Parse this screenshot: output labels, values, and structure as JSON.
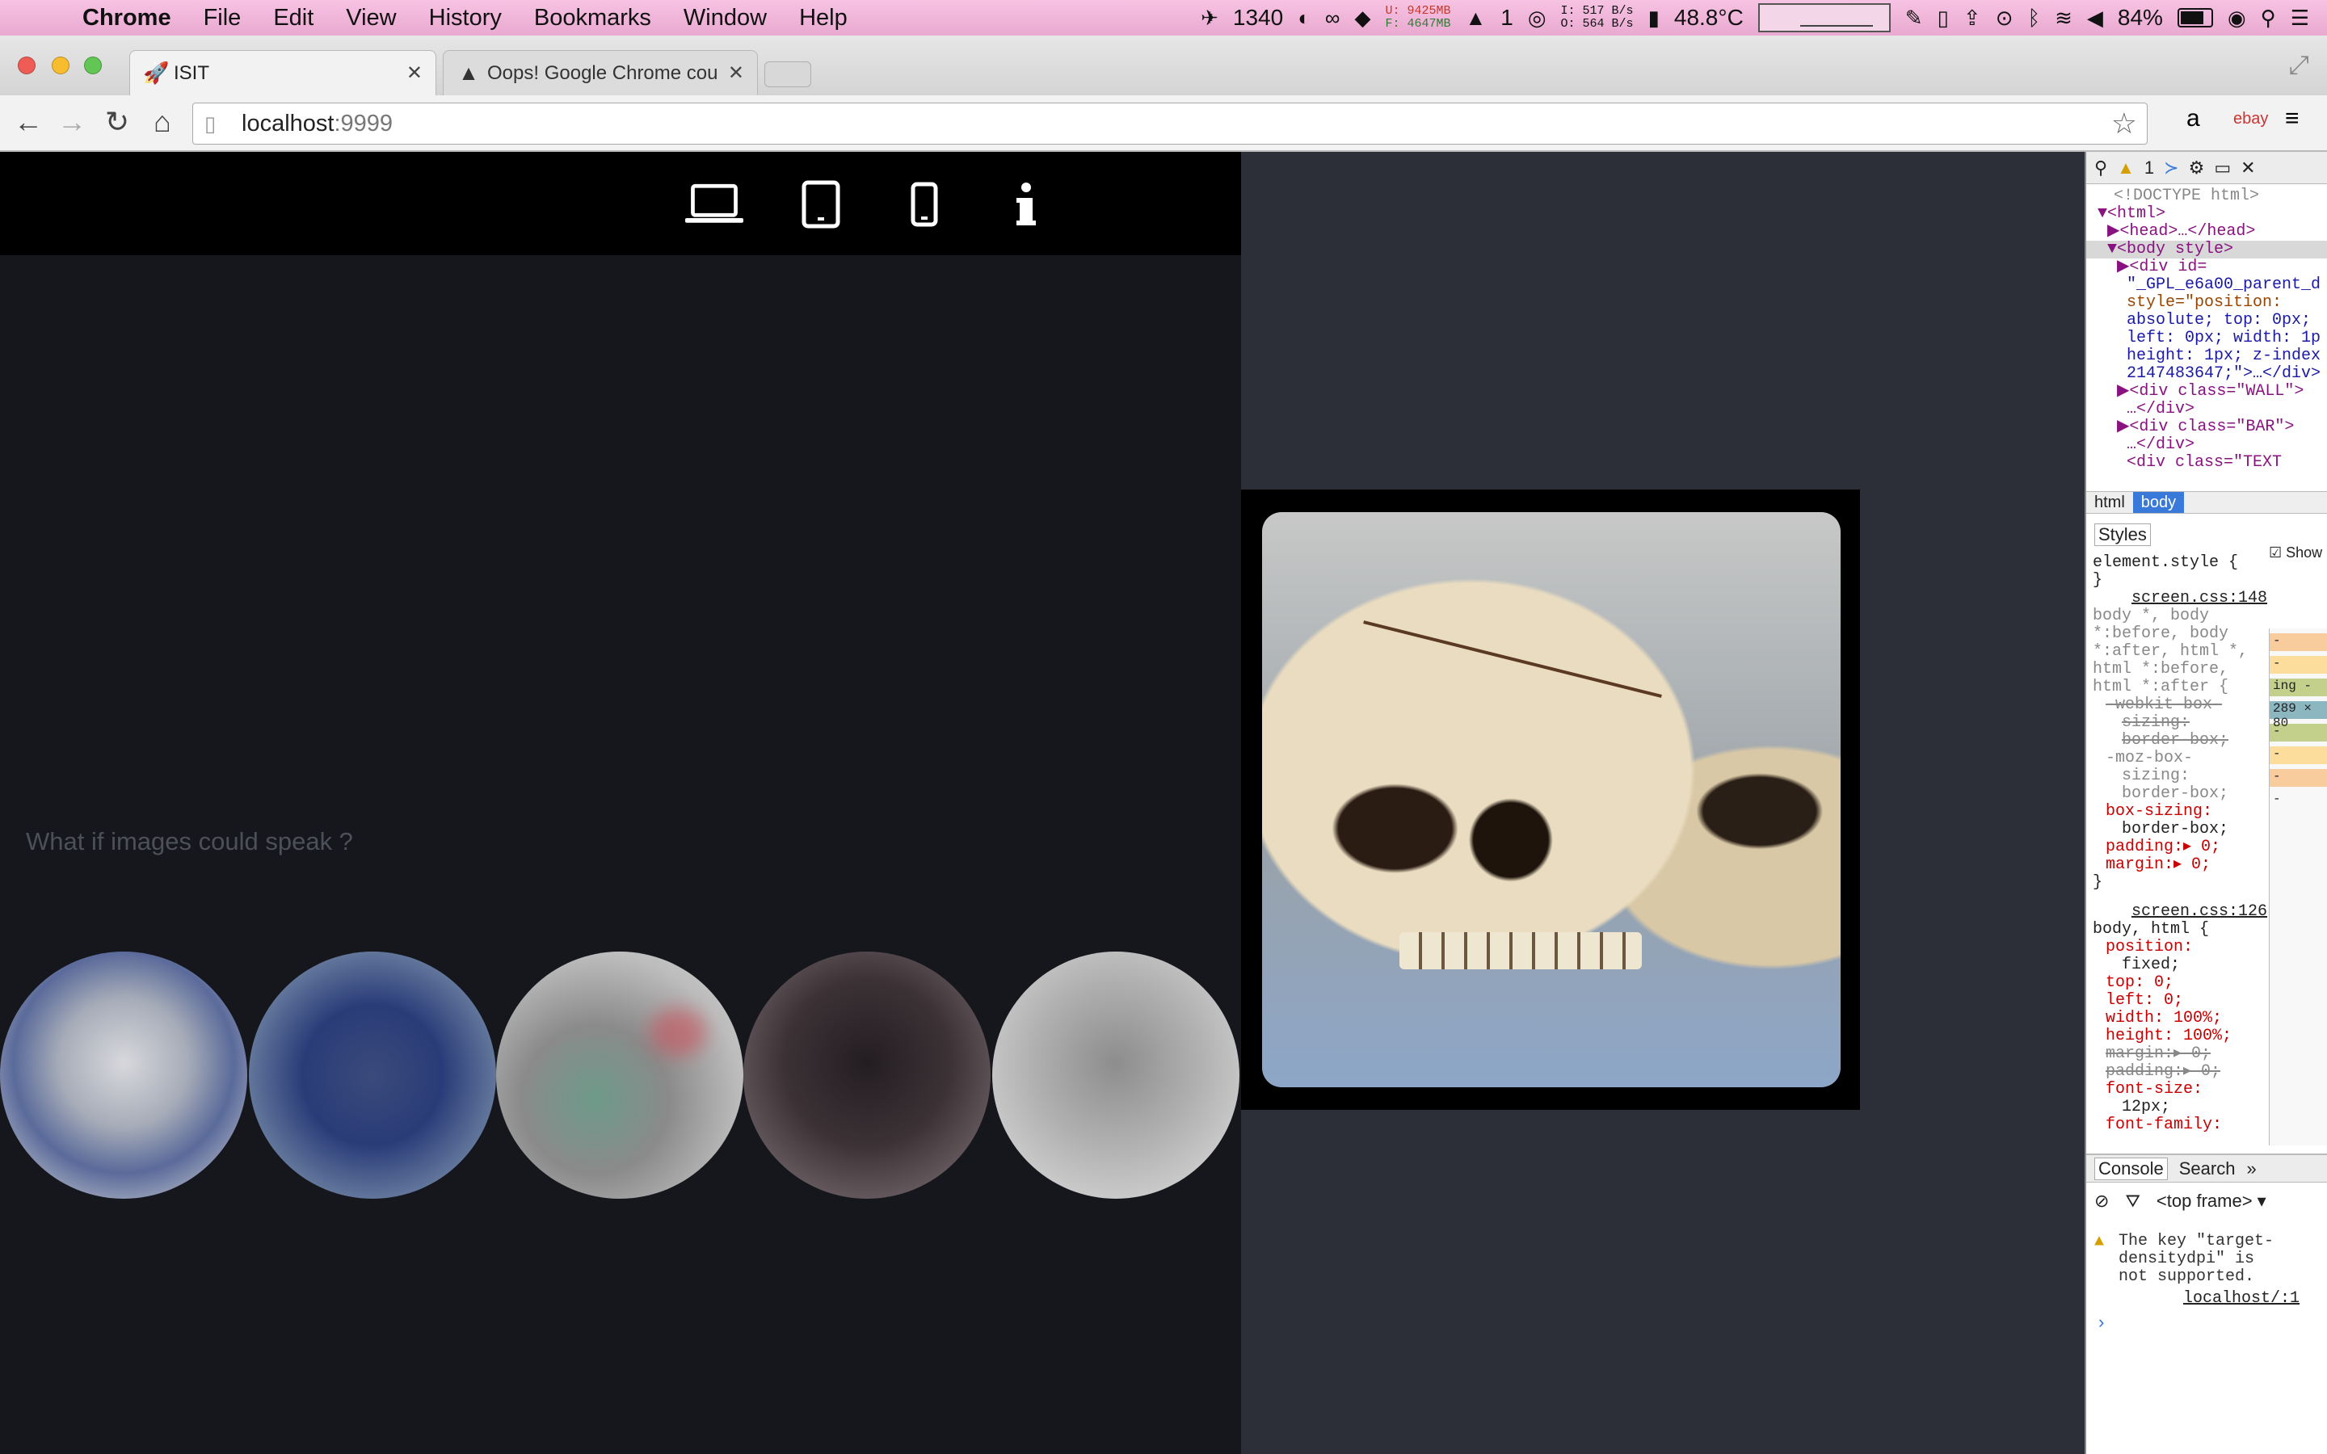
{
  "menubar": {
    "app": "Chrome",
    "items": [
      "File",
      "Edit",
      "View",
      "History",
      "Bookmarks",
      "Window",
      "Help"
    ],
    "status": {
      "count": "1340",
      "mem_u_label": "U:",
      "mem_u": "9425MB",
      "mem_f_label": "F:",
      "mem_f": "4647MB",
      "notif_count": "1",
      "net_i_label": "I:",
      "net_i": "517 B/s",
      "net_o_label": "O:",
      "net_o": "564 B/s",
      "temp": "48.8°C",
      "battery": "84%"
    }
  },
  "tabs": [
    {
      "label": "ISIT"
    },
    {
      "label": "Oops! Google Chrome cou"
    }
  ],
  "toolbar": {
    "url_host": "localhost",
    "url_port": ":9999"
  },
  "page": {
    "tagline": "What if images could speak ?",
    "device_icons": [
      "laptop-icon",
      "tablet-icon",
      "phone-icon",
      "info-icon"
    ]
  },
  "devtools": {
    "warnings_count": "1",
    "elements": {
      "doctype": "<!DOCTYPE html>",
      "html_open": "<html>",
      "head": "<head>…</head>",
      "body": "<body style>",
      "div1_open": "<div id=",
      "div1_id": "\"_GPL_e6a00_parent_d",
      "div1_style1": "style=\"position:",
      "div1_style2": "absolute; top: 0px;",
      "div1_style3": "left: 0px; width: 1p",
      "div1_style4": "height: 1px; z-index",
      "div1_style5": "2147483647;\">…</div>",
      "div_wall": "<div class=\"WALL\">",
      "div_wall_close": "…</div>",
      "div_bar": "<div class=\"BAR\">",
      "div_bar_close": "…</div>",
      "div_text": "<div class=\"TEXT"
    },
    "breadcrumbs": [
      "html",
      "body"
    ],
    "styles_tab": "Styles",
    "show_inherited": "Show inherited",
    "styles": {
      "element_style": "element.style {",
      "close": "}",
      "rule1_src": "screen.css:148",
      "rule1_sel1": "body *, body",
      "rule1_sel2": "*:before, body",
      "rule1_sel3": "*:after, html *,",
      "rule1_sel4": "html *:before,",
      "rule1_sel5": "html *:after {",
      "r1p1a": "-webkit-box-",
      "r1p1b": "sizing:",
      "r1p1c": "border-box;",
      "r1p2a": "-moz-box-",
      "r1p2b": "sizing:",
      "r1p2c": "border-box;",
      "r1p3a": "box-sizing:",
      "r1p3b": "border-box;",
      "r1p4": "padding:▸ 0;",
      "r1p5": "margin:▸ 0;",
      "rule2_src": "screen.css:126",
      "rule2_sel": "body, html {",
      "r2p1a": "position:",
      "r2p1b": "fixed;",
      "r2p2": "top: 0;",
      "r2p3": "left: 0;",
      "r2p4": "width: 100%;",
      "r2p5": "height: 100%;",
      "r2p6": "margin:▸ 0;",
      "r2p7": "padding:▸ 0;",
      "r2p8a": "font-size:",
      "r2p8b": "12px;",
      "r2p9": "font-family:"
    },
    "metrics": [
      "-",
      "-",
      "ing -",
      "289 × 80",
      "-",
      "-",
      "-",
      "-"
    ],
    "console": {
      "tabs": [
        "Console",
        "Search"
      ],
      "frame": "<top frame>",
      "warning": "The key \"target-\ndensitydpi\" is\nnot supported.",
      "source": "localhost/:1"
    }
  },
  "colors": {
    "menubar": "#f0b4d8",
    "page_bg": "#2c2f38",
    "left_panel": "#15171c",
    "icon_bar": "#000000"
  }
}
